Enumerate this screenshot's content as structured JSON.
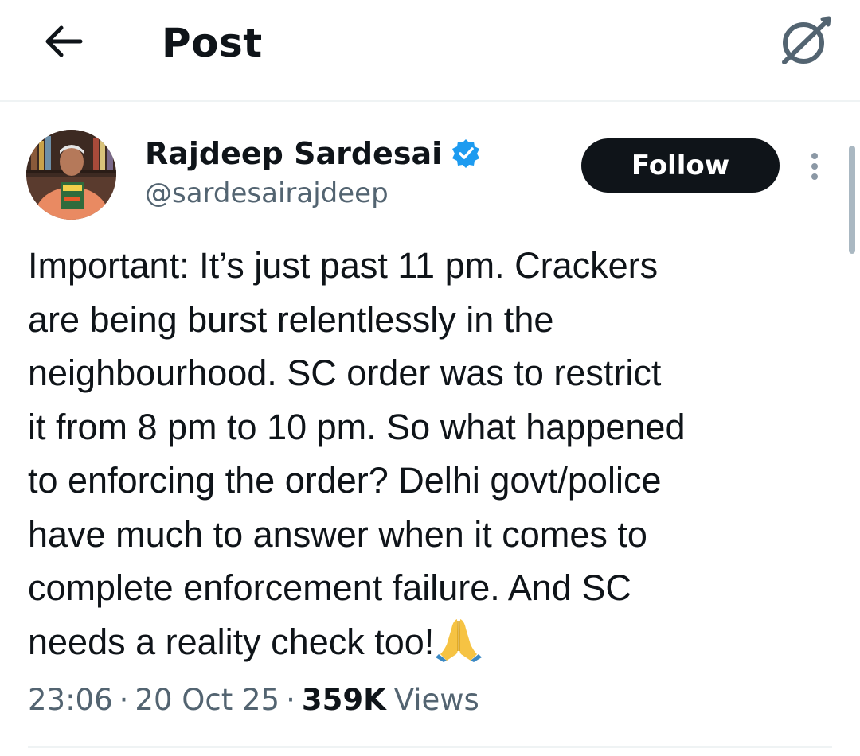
{
  "header": {
    "title": "Post",
    "back_icon": "arrow-left-icon",
    "grok_icon": "grok-slash-icon"
  },
  "author": {
    "name": "Rajdeep Sardesai",
    "handle": "@sardesairajdeep",
    "verified": true,
    "verified_color": "#1d9bf0"
  },
  "follow_button": {
    "label": "Follow"
  },
  "post": {
    "text": "Important: It’s just past 11 pm. Crackers\nare being burst relentlessly in the\nneighbourhood. SC order was to restrict\nit from 8 pm to 10 pm. So what happened\nto enforcing the order? Delhi govt/police\nhave much to answer when it comes to\ncomplete enforcement failure. And SC\nneeds a reality check too!",
    "emoji": "folded-hands-emoji"
  },
  "meta": {
    "time": "23:06",
    "separator": "·",
    "date": "20 Oct 25",
    "views_count": "359K",
    "views_label": "Views"
  },
  "colors": {
    "text_primary": "#0f1419",
    "text_secondary": "#536471",
    "follow_bg": "#0f1419",
    "follow_text": "#ffffff",
    "divider": "#eff3f4"
  }
}
